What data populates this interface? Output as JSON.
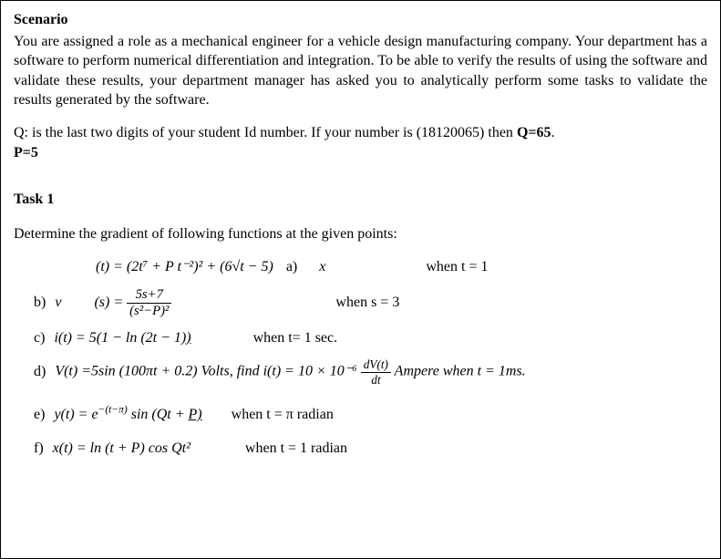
{
  "scenario": {
    "heading": "Scenario",
    "intro": "You are assigned a role as a mechanical engineer for a vehicle design manufacturing company. Your department has a software to perform numerical differentiation and integration. To be able to verify the results of using the software and validate these results, your department manager has asked you to analytically perform some tasks to validate the results generated by the software.",
    "q_line_prefix": "Q: is the last two digits of your student Id number. If your number is (18120065) then ",
    "q_bold": "Q=65",
    "period": ".",
    "p_line": "P=5"
  },
  "task": {
    "heading": "Task 1",
    "prompt": "Determine the gradient of following functions at the given points:"
  },
  "items": {
    "a": {
      "eq": "(t) = (2t⁷ + P t⁻²)² + (6√t − 5)",
      "lbl": "a)",
      "x": "x",
      "when": "when t = 1"
    },
    "b": {
      "lbl": "b)",
      "v": "v",
      "lhs": "(s) =",
      "num": "5s+7",
      "den": "(s²−P)²",
      "when": "when s = 3"
    },
    "c": {
      "lbl": "c)",
      "eq_pre": "i(t) = 5(1 − ln (2t − 1",
      "eq_tail": "))",
      "when": "when t= 1 sec."
    },
    "d": {
      "lbl": "d)",
      "eq_pre": "V(t) =5sin (100πt + 0.2) Volts, find i(t) = 10 × 10⁻⁶ ",
      "frac_num": "dV(t)",
      "frac_den": "dt",
      "eq_post": " Ampere when t = 1ms."
    },
    "e": {
      "lbl": "e)",
      "eq_pre": "y(t) = e",
      "exp": "−(t−π)",
      "eq_mid": " sin (Qt + ",
      "p_under": "P)",
      "when": "when t = π radian"
    },
    "f": {
      "lbl": "f)",
      "eq": "x(t) = ln (t + P) cos Qt²",
      "when": "when t = 1 radian"
    }
  }
}
